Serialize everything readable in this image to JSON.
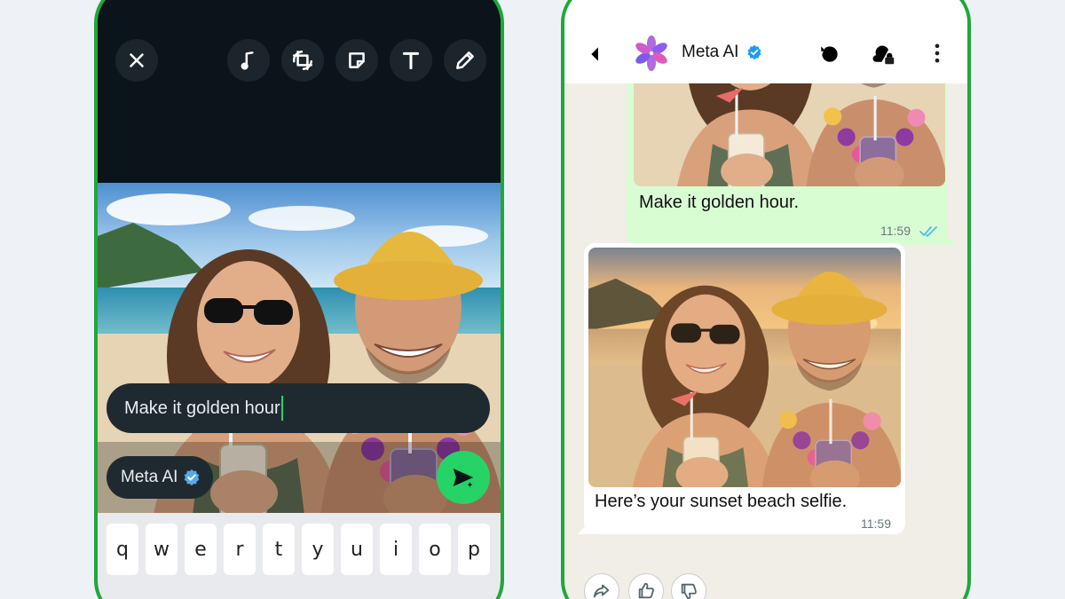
{
  "editor": {
    "tools": [
      {
        "name": "close-icon"
      },
      {
        "name": "music-icon"
      },
      {
        "name": "crop-rotate-icon"
      },
      {
        "name": "sticker-icon"
      },
      {
        "name": "text-icon"
      },
      {
        "name": "pencil-icon"
      }
    ],
    "caption_input": "Make it golden hour",
    "recipient": "Meta AI",
    "send_icon": "send-ai-icon",
    "keyboard_keys": [
      "q",
      "w",
      "e",
      "r",
      "t",
      "y",
      "u",
      "i",
      "o",
      "p"
    ]
  },
  "chat": {
    "title": "Meta AI",
    "verified_color": "#1d9bf0",
    "outgoing": {
      "text": "Make it golden hour.",
      "time": "11:59",
      "status": "read"
    },
    "incoming": {
      "text": "Here’s your sunset beach selfie.",
      "time": "11:59"
    },
    "reactions": [
      "share-icon",
      "thumbs-up-icon",
      "thumbs-down-icon"
    ]
  },
  "colors": {
    "accent": "#25d366",
    "frame": "#1fa83a",
    "outgoing_bubble": "#d9fdd3",
    "read_ticks": "#53bdeb"
  }
}
